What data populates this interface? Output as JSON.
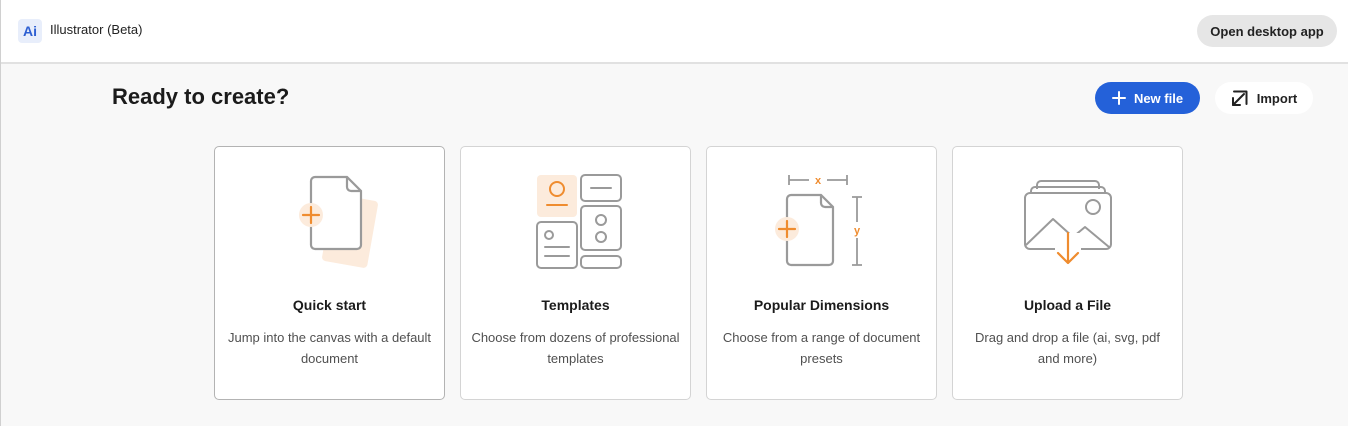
{
  "header": {
    "logo_text": "Ai",
    "app_name": "Illustrator (Beta)",
    "open_desktop_label": "Open desktop app"
  },
  "main": {
    "title": "Ready to create?",
    "new_file_label": "New file",
    "import_label": "Import"
  },
  "cards": [
    {
      "title": "Quick start",
      "description": "Jump into the canvas with a default document",
      "icon": "quick-start-icon"
    },
    {
      "title": "Templates",
      "description": "Choose from dozens of professional templates",
      "icon": "templates-icon"
    },
    {
      "title": "Popular Dimensions",
      "description": "Choose from a range of document presets",
      "icon": "dimensions-icon"
    },
    {
      "title": "Upload a File",
      "description": "Drag and drop a file (ai, svg, pdf and more)",
      "icon": "upload-icon"
    }
  ],
  "dimension_labels": {
    "x": "x",
    "y": "y"
  },
  "colors": {
    "accent": "#2461d9",
    "orange": "#ef8c2f",
    "orange_light": "#fcebdc",
    "icon_gray": "#9a9a9a"
  }
}
